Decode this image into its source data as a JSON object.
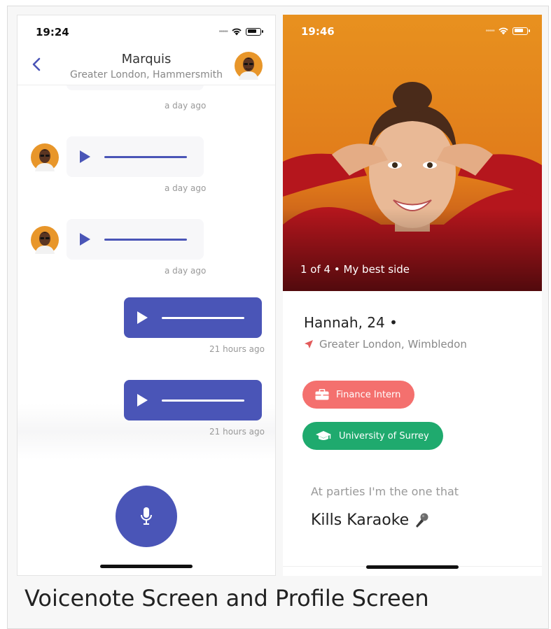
{
  "chat_screen": {
    "status_time": "19:24",
    "contact_name": "Marquis",
    "contact_location": "Greater London, Hammersmith",
    "messages": [
      {
        "direction": "in",
        "timestamp": "a day ago"
      },
      {
        "direction": "in",
        "timestamp": "a day ago"
      },
      {
        "direction": "in",
        "timestamp": "a day ago"
      },
      {
        "direction": "out",
        "timestamp": "21 hours ago"
      },
      {
        "direction": "out",
        "timestamp": "21 hours ago"
      }
    ]
  },
  "profile_screen": {
    "status_time": "19:46",
    "photo_caption": "1 of 4 • My best side",
    "name_age": "Hannah, 24 •",
    "location": "Greater London, Wimbledon",
    "job": "Finance Intern",
    "school": "University of Surrey",
    "prompt_question": "At parties I'm the one that",
    "prompt_answer": "Kills Karaoke"
  },
  "caption": "Voicenote Screen and Profile Screen",
  "colors": {
    "accent": "#4a55b7",
    "job_pill": "#f4706e",
    "school_pill": "#1faa6e",
    "location_pin": "#e25b5b",
    "photo_background": "#e8911f"
  }
}
